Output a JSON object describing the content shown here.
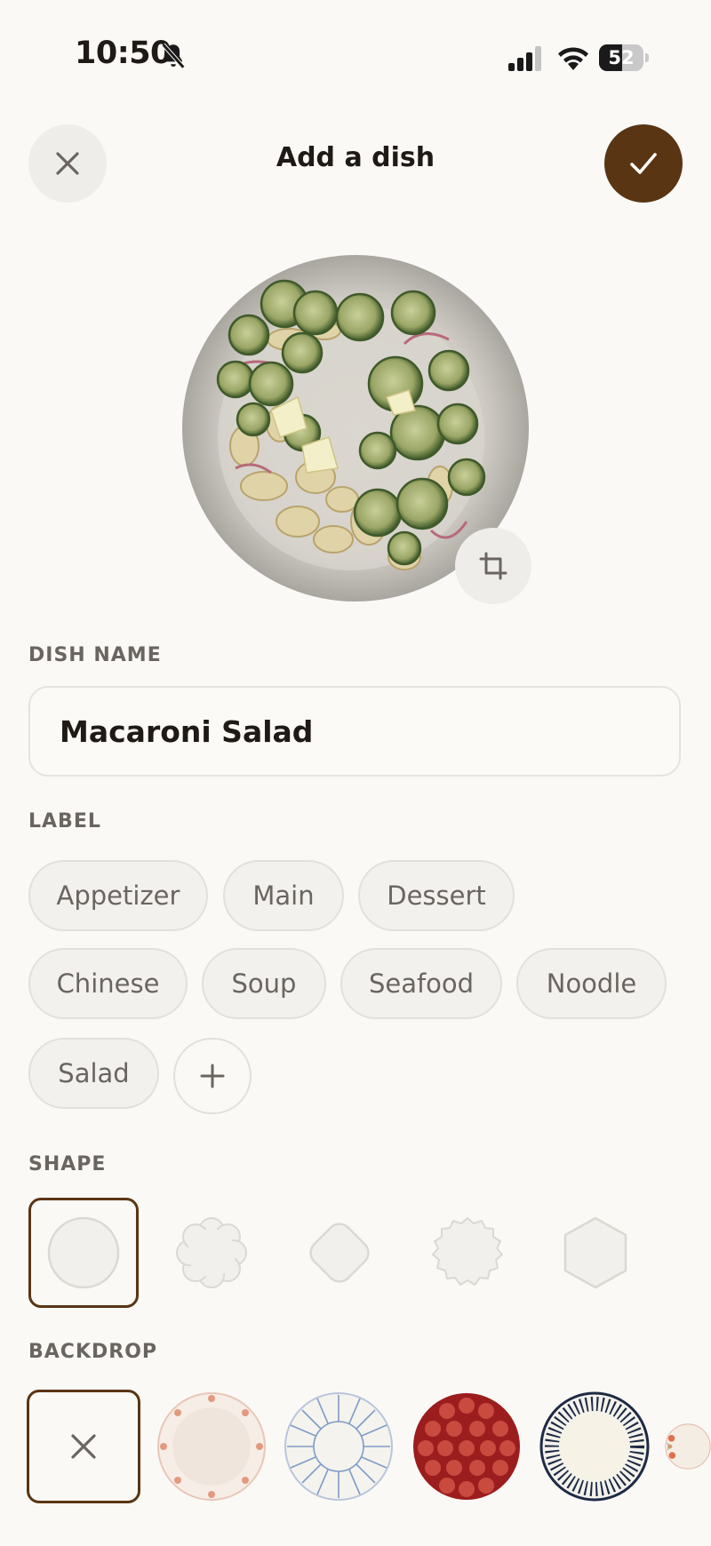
{
  "status_bar": {
    "time": "10:50",
    "battery_level": "52",
    "icons": [
      "bell-slash-icon",
      "cellular-signal-icon",
      "wifi-icon",
      "battery-icon"
    ]
  },
  "header": {
    "title": "Add a dish",
    "close_icon": "close-icon",
    "confirm_icon": "checkmark-icon"
  },
  "photo": {
    "crop_icon": "crop-icon"
  },
  "dish_name": {
    "label": "DISH NAME",
    "value": "Macaroni Salad"
  },
  "label_section": {
    "label": "LABEL",
    "chips": [
      "Appetizer",
      "Main",
      "Dessert",
      "Chinese",
      "Soup",
      "Seafood",
      "Noodle",
      "Salad"
    ],
    "add_icon": "plus-icon"
  },
  "shape_section": {
    "label": "SHAPE",
    "options": [
      "circle",
      "flower",
      "rounded-diamond",
      "scalloped",
      "hexagon"
    ],
    "selected": "circle"
  },
  "backdrop_section": {
    "label": "BACKDROP",
    "options": [
      "none",
      "dotted-rim-plate",
      "blue-petal-plate",
      "red-polka-plate",
      "striped-rim-plate",
      "floral-plate"
    ],
    "selected": "none"
  },
  "colors": {
    "accent": "#5a3513",
    "background": "#faf9f6",
    "chip_bg": "#f3f1ee",
    "muted_text": "#6a6560"
  }
}
